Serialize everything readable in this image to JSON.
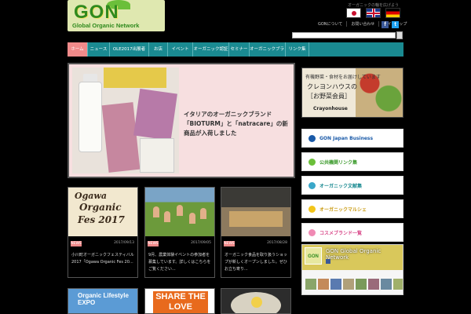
{
  "header": {
    "logo_text": "GON",
    "logo_tagline": "Global Organic Network",
    "top_note": "オーガニックの輪を広げよう",
    "flags": [
      "jp-flag-icon",
      "uk-flag-icon",
      "de-flag-icon"
    ],
    "top_links": [
      "GONについて",
      "お問い合わせ",
      "サイトマップ"
    ],
    "social": {
      "facebook": "f",
      "twitter": "t"
    },
    "search": {
      "placeholder": "",
      "value": ""
    }
  },
  "nav": {
    "items": [
      {
        "label": "ホーム",
        "active": true
      },
      {
        "label": "ニュース"
      },
      {
        "label": "OLE2017出展者"
      },
      {
        "label": "お店"
      },
      {
        "label": "イベント"
      },
      {
        "label": "オーガニック認証"
      },
      {
        "label": "セミナー"
      },
      {
        "label": "オーガニックブランド"
      },
      {
        "label": "リンク集"
      }
    ]
  },
  "slider": {
    "caption": "イタリアのオーガニックブランド「BIOTURM」と「natracare」の新商品が入荷しました"
  },
  "sidebar": {
    "crayon": {
      "line1": "有機野菜・食材をお届けしています",
      "line2": "クレヨンハウスの",
      "line3": "［お野菜会員］",
      "brand": "Crayonhouse"
    },
    "buttons": [
      {
        "label": "GON Japan Business",
        "color": "#1a5aa8",
        "dot": "#1a5aa8"
      },
      {
        "label": "公共機関リンク集",
        "color": "#3a9a2a",
        "dot": "#6bbf3a"
      },
      {
        "label": "オーガニック文献集",
        "color": "#1a8a91",
        "dot": "#3aa7c9"
      },
      {
        "label": "オーガニックマルシェ",
        "color": "#c99a10",
        "dot": "#f2c51a"
      },
      {
        "label": "コスメブランド一覧",
        "color": "#d94a8a",
        "dot": "#f08ab4"
      }
    ],
    "facebook_widget": {
      "page_name": "GON Global Organic Network",
      "icon_text": "GON"
    }
  },
  "posts": [
    {
      "thumb_lines": [
        "Ogawa",
        "Organic",
        "Fes 2017"
      ],
      "badge": "NEWS",
      "date": "2017/09/13",
      "text": "小川町オーガニックフェスティバル2017「Ogawa Organic Fes 20..."
    },
    {
      "badge": "NEWS",
      "date": "2017/09/05",
      "text": "9月、農業体験イベントの参加者を募集しています。詳しくはこちらをご覧ください..."
    },
    {
      "badge": "NEWS",
      "date": "2017/08/28",
      "text": "オーガニック食品を取り扱うショップが新しくオープンしました。ぜひお立ち寄り..."
    }
  ],
  "bottom_banners": {
    "b1": "Organic Lifestyle EXPO",
    "b2": "SHARE THE LOVE"
  }
}
